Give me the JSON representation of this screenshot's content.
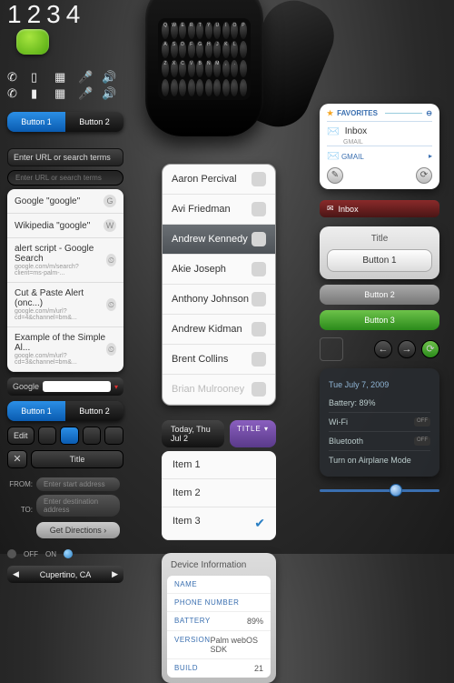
{
  "dialer": {
    "number": "1234"
  },
  "btn_row1": {
    "a": "Button 1",
    "b": "Button 2"
  },
  "url_label": "Enter URL or search terms",
  "url_placeholder": "Enter URL or search terms",
  "suggest": [
    {
      "t": "Google \"google\"",
      "icon": "G"
    },
    {
      "t": "Wikipedia \"google\"",
      "icon": "W"
    },
    {
      "t": "alert script - Google Search",
      "s": "google.com/m/search?client=ms-palm-...",
      "icon": "⏲"
    },
    {
      "t": "Cut & Paste Alert (onc...)",
      "s": "google.com/m/url?cd=4&channel=bm&...",
      "icon": "⏲"
    },
    {
      "t": "Example of the Simple Al...",
      "s": "google.com/m/url?cd=3&channel=bm&...",
      "icon": "⏲"
    }
  ],
  "google_label": "Google",
  "btn_row2": {
    "a": "Button 1",
    "b": "Button 2"
  },
  "edit_label": "Edit",
  "title_label": "Title",
  "from_lbl": "FROM:",
  "from_ph": "Enter start address",
  "to_lbl": "TO:",
  "to_ph": "Enter destination address",
  "getdir": "Get Directions ›",
  "off": "OFF",
  "on": "ON",
  "nav_loc": "Cupertino, CA",
  "contacts": [
    "Aaron Percival",
    "Avi Friedman",
    "Andrew Kennedy",
    "Akie Joseph",
    "Anthony Johnson",
    "Andrew Kidman",
    "Brent Collins",
    "Brian Mulrooney"
  ],
  "contacts_sel_index": 2,
  "date_bar": "Today, Thu Jul 2",
  "date_title": "TITLE",
  "items": [
    "Item 1",
    "Item 2",
    "Item 3"
  ],
  "dev_hdr": "Device Information",
  "dev": {
    "name_lbl": "NAME",
    "name": "",
    "phone_lbl": "PHONE NUMBER",
    "phone": "",
    "batt_lbl": "BATTERY",
    "batt": "89%",
    "ver_lbl": "VERSION",
    "ver": "Palm webOS SDK",
    "build_lbl": "BUILD",
    "build": "21"
  },
  "fav_hdr": "FAVORITES",
  "fav_inbox": "Inbox",
  "fav_sub": "GMAIL",
  "fav_gmail": "GMAIL",
  "red_inbox": "Inbox",
  "panel_title": "Title",
  "panel_btn1": "Button 1",
  "panel_btn2": "Button 2",
  "panel_btn3": "Button 3",
  "status": {
    "date": "Tue July 7, 2009",
    "batt": "Battery: 89%",
    "wifi": "Wi-Fi",
    "wifi_s": "OFF",
    "bt": "Bluetooth",
    "bt_s": "OFF",
    "air": "Turn on Airplane Mode"
  },
  "keys": "QWERTYUIOPASDFGHJKL ZXCVBNM,. "
}
